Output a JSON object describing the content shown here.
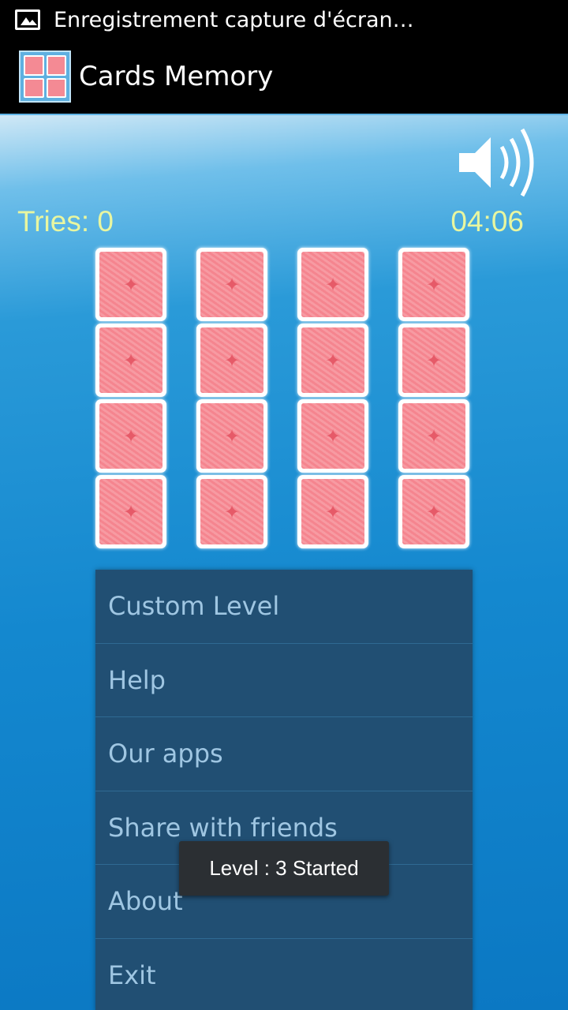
{
  "status_bar": {
    "notification_icon": "image-icon",
    "text": "Enregistrement capture d'écran…"
  },
  "action_bar": {
    "app_icon": "cards-app-icon",
    "title": "Cards Memory"
  },
  "game": {
    "tries_label": "Tries: 0",
    "timer": "04:06",
    "sound_icon": "speaker-icon",
    "grid": {
      "rows": 4,
      "columns": 4,
      "face_down_cards": 16
    }
  },
  "menu": {
    "items": [
      {
        "label": "Custom Level"
      },
      {
        "label": "Help"
      },
      {
        "label": "Our apps"
      },
      {
        "label": "Share with friends"
      },
      {
        "label": "About"
      },
      {
        "label": "Exit"
      }
    ]
  },
  "toast": {
    "text": "Level : 3 Started"
  },
  "colors": {
    "hud_text": "#e8f6a0",
    "menu_bg": "#214f73",
    "menu_text": "#9fc6e2",
    "card_back": "#f5858f",
    "background_blue": "#1488cf"
  }
}
